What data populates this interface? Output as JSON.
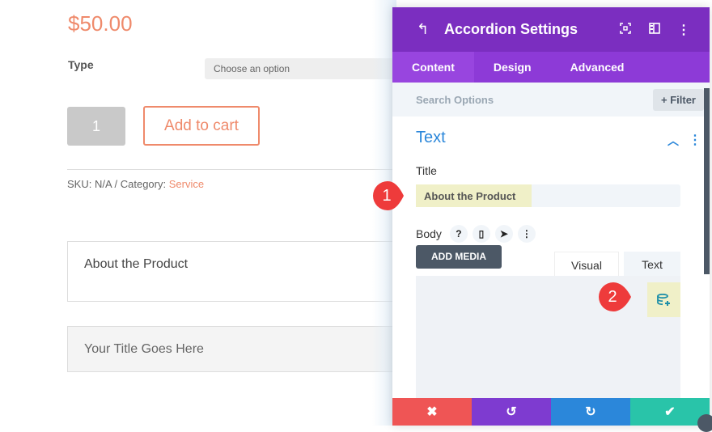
{
  "product": {
    "price": "$50.00",
    "type_label": "Type",
    "type_select": "Choose an option",
    "quantity": "1",
    "add_to_cart": "Add to cart",
    "meta_prefix": "SKU: N/A / Category: ",
    "category": "Service",
    "accordion": [
      {
        "title": "About the Product"
      },
      {
        "title": "Your Title Goes Here"
      }
    ]
  },
  "panel": {
    "title": "Accordion Settings",
    "tabs": [
      "Content",
      "Design",
      "Advanced"
    ],
    "active_tab": "Content",
    "search_placeholder": "Search Options",
    "filter_label": "+ Filter",
    "section_title": "Text",
    "title_label": "Title",
    "title_value": "About the Product",
    "body_label": "Body",
    "add_media": "ADD MEDIA",
    "editor_tabs": [
      "Visual",
      "Text"
    ]
  },
  "annotations": [
    "1",
    "2"
  ],
  "colors": {
    "accent_orange": "#ef8a6b",
    "panel_purple": "#7b2ec0",
    "tab_purple": "#8d3ad7",
    "section_blue": "#2b87da",
    "close_red": "#ef5555",
    "save_green": "#29c4a9"
  }
}
